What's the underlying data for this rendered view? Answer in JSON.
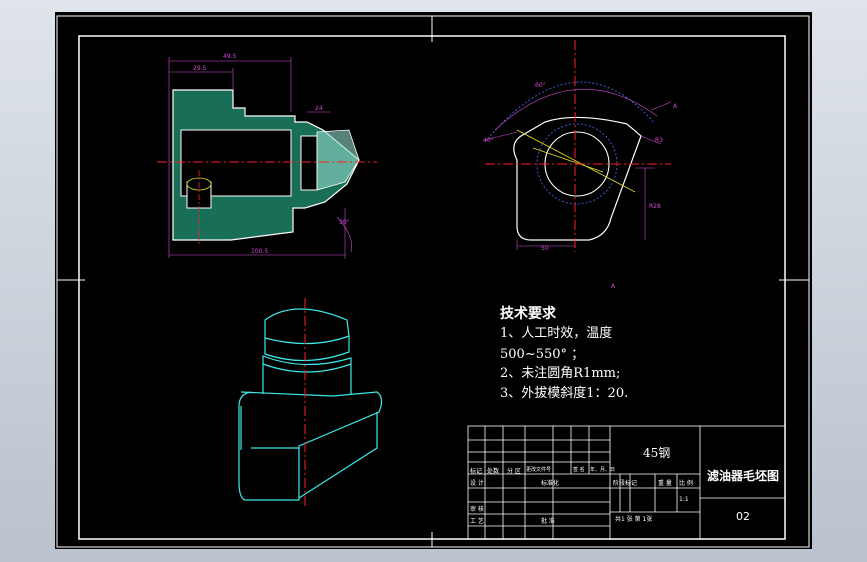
{
  "tech_notes": {
    "heading": "技术要求",
    "line1": "1、人工时效，温度",
    "line2": "500~550°  ；",
    "line3": "2、未注圆角R1mm;",
    "line4": "3、外拔模斜度1：20."
  },
  "title_block": {
    "material": "45钢",
    "drawing_title": "滤油器毛坯图",
    "drawing_number": "02",
    "scale": "1:1",
    "sheet_info": "共1 张  第 1张",
    "col_mark": "标记",
    "col_count": "处数",
    "col_zone": "分 区",
    "col_doc": "更改文件号",
    "col_sign": "签 名",
    "col_date": "年、月、日",
    "row_design": "设 计",
    "row_standard": "标准化",
    "row_review": "审 核",
    "row_process": "工 艺",
    "row_approve": "批 准",
    "stage_mark": "阶段标记",
    "weight": "重 量",
    "ratio": "比 例"
  },
  "dimensions": {
    "d1": "49.5",
    "d2": "29.5",
    "d3": "24",
    "d4": "100.5",
    "d5": "30°",
    "d6": "60°",
    "d7": "R3",
    "d8": "A",
    "d9": "50",
    "d10": "40°",
    "d11": "R28",
    "d12": "A"
  },
  "colors": {
    "background": "#000000",
    "outline": "#ffffff",
    "section_hatch": "#2ec9a0",
    "centerline": "#ff2020",
    "dimension": "#d34ad6",
    "isometric": "#3de8e8",
    "arc_dotted": "#3a5bd6",
    "hidden_yellow": "#e8e020"
  }
}
